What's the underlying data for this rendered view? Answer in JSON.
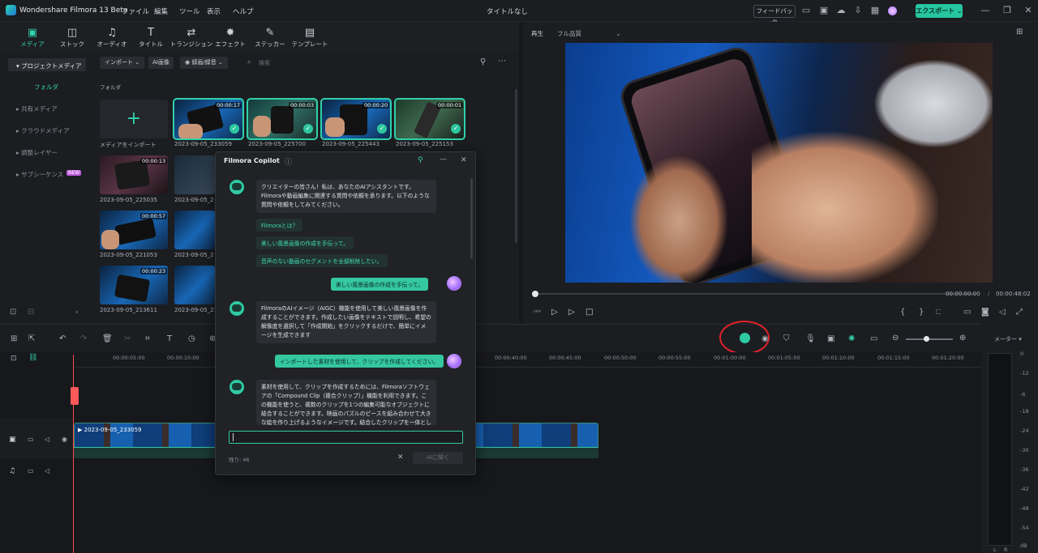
{
  "app": {
    "title": "Wondershare Filmora 13 Beta",
    "doc_title": "タイトルなし"
  },
  "menu": [
    "ファイル",
    "編集",
    "ツール",
    "表示",
    "ヘルプ"
  ],
  "titlebar": {
    "feedback": "フィードバック",
    "export": "エクスポート"
  },
  "tools": [
    "メディア",
    "ストック",
    "オーディオ",
    "タイトル",
    "トランジション",
    "エフェクト",
    "ステッカー",
    "テンプレート"
  ],
  "sidebar": {
    "project_media": "プロジェクトメディア",
    "folder": "フォルダ",
    "items": [
      "共有メディア",
      "クラウドメディア",
      "調整レイヤー",
      "サブシーケンス"
    ],
    "new_badge": "NEW"
  },
  "media": {
    "import_btn": "インポート",
    "ai_image": "AI画像",
    "record_btn": "録画/録音",
    "search_placeholder": "検索",
    "folder_label": "フォルダ",
    "import_caption": "メディアをインポート",
    "clips": [
      {
        "name": "2023-09-05_233059",
        "dur": "00:00:17"
      },
      {
        "name": "2023-09-05_225700",
        "dur": "00:00:03"
      },
      {
        "name": "2023-09-05_225443",
        "dur": "00:00:20"
      },
      {
        "name": "2023-09-05_225153",
        "dur": "00:00:01"
      },
      {
        "name": "2023-09-05_225035",
        "dur": "00:00:13"
      },
      {
        "name": "2023-09-05_221053",
        "dur": "00:00:57"
      },
      {
        "name": "2023-09-05_213611",
        "dur": "00:00:23"
      }
    ],
    "clips_partial": [
      "2023-09-05_2",
      "2023-09-05_2",
      "2023-09-05_21"
    ]
  },
  "player": {
    "tab": "再生",
    "quality": "フル品質",
    "time_current": "00:00:00:00",
    "time_total": "00:00:48:02",
    "separator": "/"
  },
  "copilot": {
    "title": "Filmora Copilot",
    "intro": "クリエイターの皆さん！私は、あなたのAIアシスタントです。Filmoraや動画編集に関連する質問や依頼を承ります。以下のような質問や依頼をしてみてください。",
    "suggestions": [
      "Filmoraとは？",
      "美しい風景画像の作成を手伝って。",
      "音声のない動画のセグメントを全部削除したい。"
    ],
    "user1": "美しい風景画像の作成を手伝って。",
    "reply1": "FilmoraのAIイメージ（AIGC）機能を使用して美しい風景画像を作成することができます。作成したい画像をテキストで説明し、希望の解像度を選択して「作成開始」をクリックするだけで、簡単にイメージを生成できます",
    "user2": "インポートした素材を使用して、クリップを作成してください。",
    "reply2": "素材を使用して、クリップを作成するためには、Filmoraソフトウェアの「Compound Clip（複合クリップ）」機能を利用できます。この機能を使うと、複数のクリップを1つの編集可能なオブジェクトに結合することができます。映画のパズルのピースを組み合わせて大きな絵を作り上げるようなイメージです。結合したクリップを一体として編",
    "remaining": "残り: 46",
    "send": "AIに聞く"
  },
  "timeline": {
    "ticks": [
      "00:00:05:00",
      "00:00:10:00",
      "00:00:40:00",
      "00:00:45:00",
      "00:00:50:00",
      "00:00:55:00",
      "00:01:00:00",
      "00:01:05:00",
      "00:01:10:00",
      "00:01:15:00",
      "00:01:20:00"
    ],
    "clip_label": "2023-09-05_233059",
    "meter_label": "メーター",
    "db": [
      "0",
      "-6",
      "-12",
      "-18",
      "-24",
      "-30",
      "-36",
      "-42",
      "-48",
      "-54",
      "dB"
    ],
    "lr": [
      "L",
      "R"
    ]
  }
}
